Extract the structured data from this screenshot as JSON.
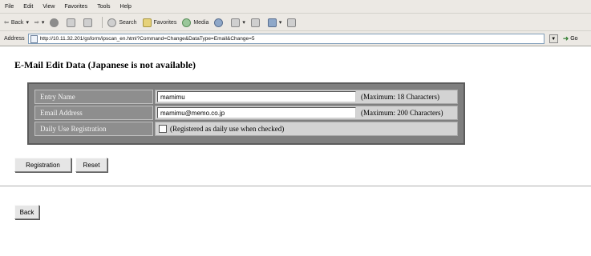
{
  "menu": {
    "items": [
      "File",
      "Edit",
      "View",
      "Favorites",
      "Tools",
      "Help"
    ]
  },
  "toolbar": {
    "back": "Back",
    "search": "Search",
    "favorites": "Favorites",
    "media": "Media"
  },
  "address": {
    "label": "Address",
    "url": "http://10.11.32.201/gsform/ipscan_en.html?Command=Change&DataType=Email&Change=5",
    "go_label": "Go"
  },
  "page": {
    "title": "E-Mail Edit Data (Japanese is not available)"
  },
  "form": {
    "entry_name": {
      "label": "Entry Name",
      "value": "mamimu",
      "hint": "(Maximum: 18 Characters)"
    },
    "email_address": {
      "label": "Email Address",
      "value": "mamimu@memo.co.jp",
      "hint": "(Maximum: 200 Characters)"
    },
    "daily_use": {
      "label": "Daily Use Registration",
      "hint": "(Registered as daily use when checked)",
      "checked": false
    }
  },
  "buttons": {
    "registration": "Registration",
    "reset": "Reset",
    "back": "Back"
  }
}
